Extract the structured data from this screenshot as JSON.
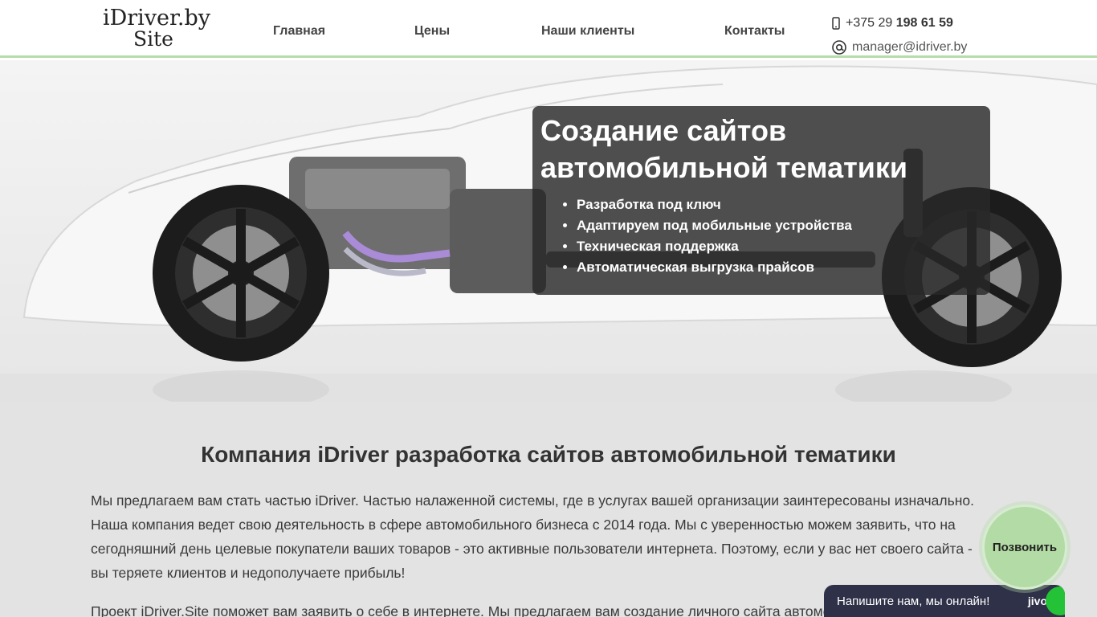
{
  "header": {
    "logo_line1": "iDriver.by",
    "logo_line2": "Site",
    "nav": [
      "Главная",
      "Цены",
      "Наши клиенты",
      "Контакты"
    ],
    "phone_prefix": "+375 29 ",
    "phone_number": "198 61 59",
    "email": "manager@idriver.by"
  },
  "hero": {
    "title_line1": "Создание сайтов",
    "title_line2": "автомобильной тематики",
    "features": [
      "Разработка под ключ",
      "Адаптируем под мобильные устройства",
      "Техническая поддержка",
      "Автоматическая выгрузка прайсов"
    ]
  },
  "content": {
    "heading": "Компания iDriver разработка сайтов автомобильной тематики",
    "paragraph1": "Мы предлагаем вам стать частью iDriver. Частью налаженной системы, где в услугах вашей организации заинтересованы изначально. Наша компания ведет свою деятельность в сфере автомобильного бизнеса с 2014 года. Мы с уверенностью можем заявить, что на сегодняшний день целевые покупатели ваших товаров - это активные пользователи интернета. Поэтому, если у вас нет своего сайта - вы теряете клиентов и недополучаете прибыль!",
    "paragraph2": "Проект iDriver.Site поможет вам заявить о себе в интернете. Мы предлагаем вам создание личного сайта автомобильной тематики"
  },
  "widgets": {
    "call_label": "Позвонить",
    "chat_label": "Напишите нам, мы онлайн!",
    "chat_brand": "jivo"
  },
  "colors": {
    "accent_green": "#b7dcac",
    "chat_bg": "#2f3148",
    "online_dot": "#24c236"
  }
}
